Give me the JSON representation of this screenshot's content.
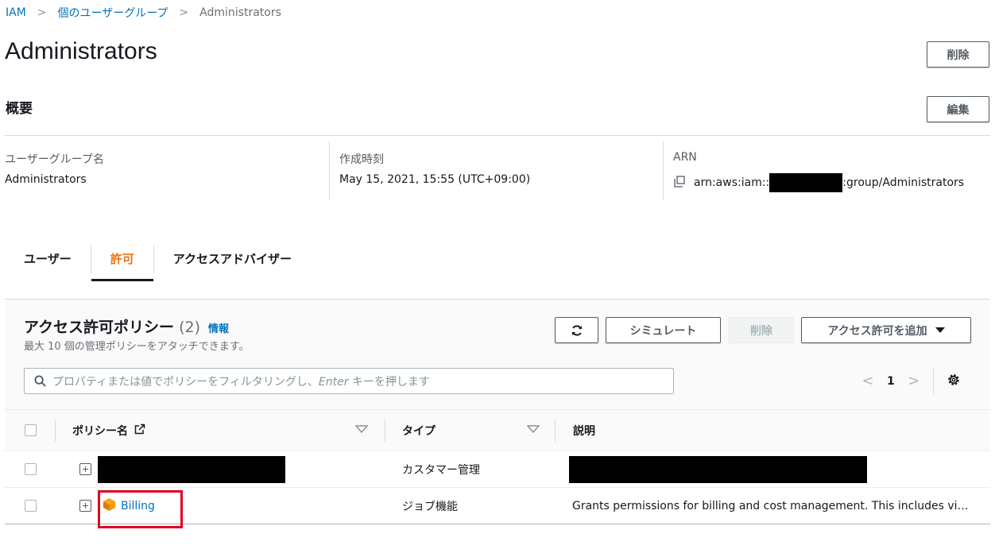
{
  "breadcrumb": {
    "items": [
      "IAM",
      "個のユーザーグループ"
    ],
    "current": "Administrators"
  },
  "page": {
    "title": "Administrators",
    "delete_label": "削除"
  },
  "summary": {
    "title": "概要",
    "edit_label": "編集",
    "group_name_label": "ユーザーグループ名",
    "group_name_value": "Administrators",
    "created_label": "作成時刻",
    "created_value": "May 15, 2021, 15:55 (UTC+09:00)",
    "arn_label": "ARN",
    "arn_prefix": "arn:aws:iam::",
    "arn_suffix": ":group/Administrators"
  },
  "tabs": [
    {
      "label": "ユーザー"
    },
    {
      "label": "許可",
      "active": true
    },
    {
      "label": "アクセスアドバイザー"
    }
  ],
  "policies": {
    "title": "アクセス許可ポリシー",
    "count": "(2)",
    "info_label": "情報",
    "description": "最大 10 個の管理ポリシーをアタッチできます。",
    "simulate_label": "シミュレート",
    "delete_label": "削除",
    "add_label": "アクセス許可を追加",
    "search_placeholder_pre": "プロパティまたは値でポリシーをフィルタリングし、",
    "search_placeholder_enter": "Enter",
    "search_placeholder_post": " キーを押します",
    "page_number": "1"
  },
  "table": {
    "columns": [
      "ポリシー名",
      "タイプ",
      "説明"
    ],
    "rows": [
      {
        "name": "",
        "type": "カスタマー管理",
        "description": "",
        "redacted": true
      },
      {
        "name": "Billing",
        "type": "ジョブ機能",
        "description": "Grants permissions for billing and cost management. This includes vi…",
        "redacted": false
      }
    ]
  },
  "colors": {
    "link": "#0073bb",
    "active_tab": "#ec7211",
    "highlight": "#e0001b"
  }
}
